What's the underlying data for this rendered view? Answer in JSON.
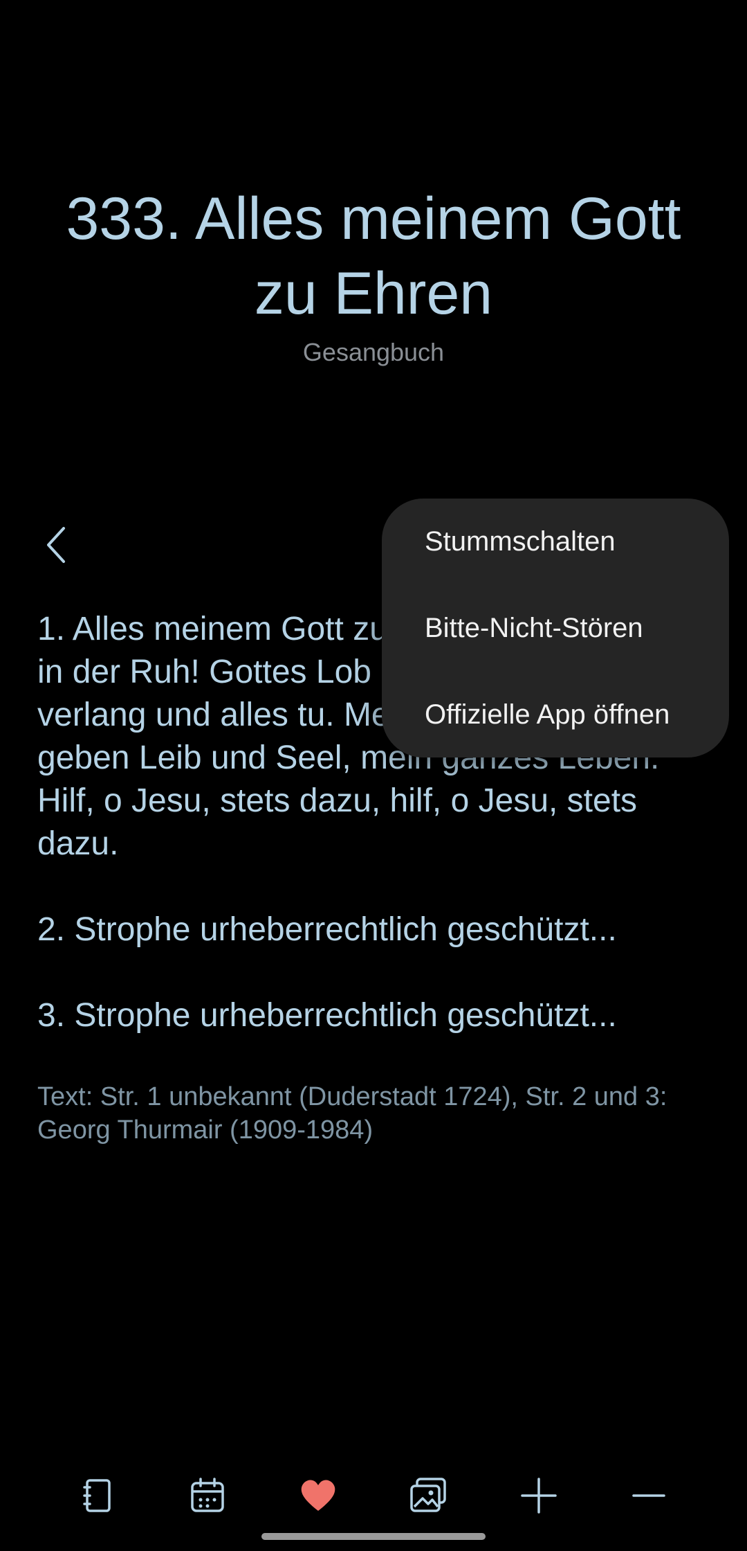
{
  "header": {
    "title": "333. Alles meinem Gott zu Ehren",
    "subtitle": "Gesangbuch"
  },
  "navigation": {
    "back_icon": "chevron-left-icon"
  },
  "hymn": {
    "verses": [
      "1. Alles meinem Gott zu Ehren, in der Arbeit, in der Ruh! Gottes Lob und Ehr zu mehren ich verlang und alles tu. Meinem Gott nur will ich geben Leib und Seel, mein ganzes Leben. Hilf, o Jesu, stets dazu, hilf, o Jesu, stets dazu.",
      "2. Strophe urheberrechtlich geschützt...",
      "3. Strophe urheberrechtlich geschützt..."
    ],
    "source": "Text: Str. 1 unbekannt (Duderstadt 1724), Str. 2 und 3: Georg Thurmair (1909-1984)"
  },
  "popup_menu": {
    "items": [
      "Stummschalten",
      "Bitte-Nicht-Stören",
      "Offizielle App öffnen"
    ]
  },
  "bottom_bar": {
    "icons": [
      "book-icon",
      "calendar-icon",
      "heart-icon",
      "gallery-icon",
      "plus-icon",
      "minus-icon"
    ],
    "colors": {
      "default": "#b5d3e6",
      "active": "#f0736a"
    }
  },
  "colors": {
    "background": "#000000",
    "text_primary": "#b5d3e6",
    "text_secondary": "#8a8f95",
    "menu_background": "#252525"
  }
}
